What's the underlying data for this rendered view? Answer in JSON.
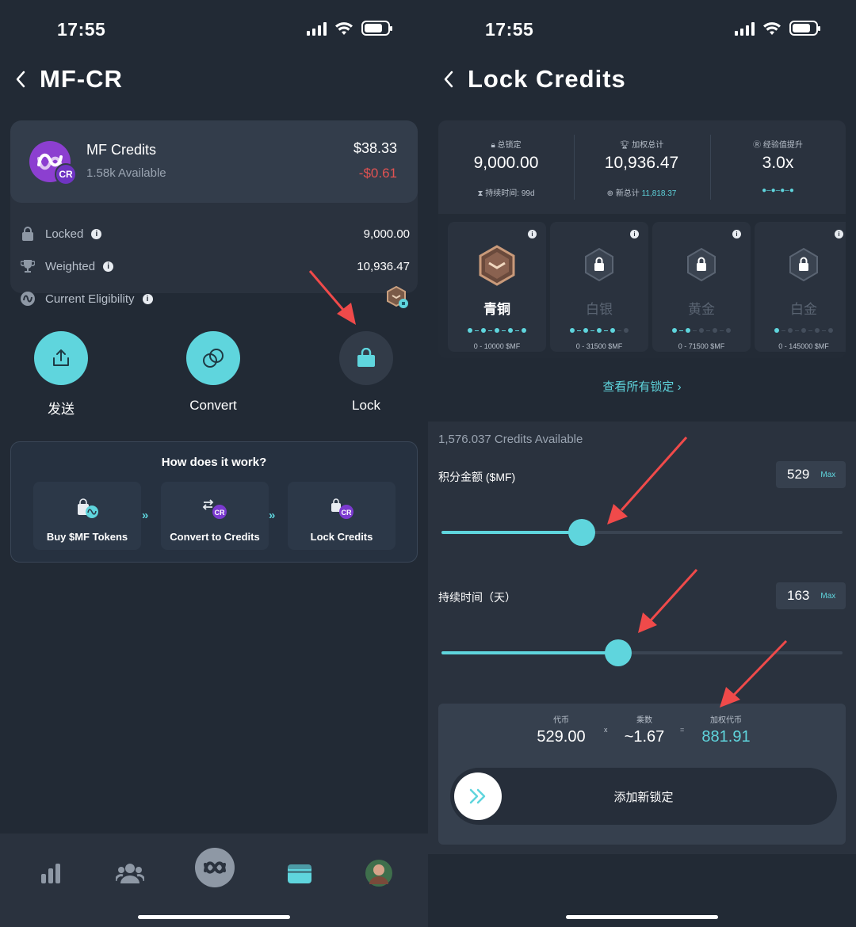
{
  "left": {
    "status": {
      "time": "17:55"
    },
    "header": {
      "title": "MF-CR"
    },
    "card": {
      "name": "MF Credits",
      "available": "1.58k Available",
      "usd_value": "$38.33",
      "change": "-$0.61",
      "coin_badge": "CR",
      "rows": [
        {
          "label": "Locked",
          "value": "9,000.00",
          "icon": "lock-icon"
        },
        {
          "label": "Weighted",
          "value": "10,936.47",
          "icon": "trophy-icon"
        },
        {
          "label": "Current Eligibility",
          "value": "",
          "icon": "token-icon"
        }
      ]
    },
    "actions": [
      {
        "label": "发送",
        "icon": "share-icon"
      },
      {
        "label": "Convert",
        "icon": "convert-icon"
      },
      {
        "label": "Lock",
        "icon": "bag-lock-icon"
      }
    ],
    "how": {
      "title": "How does it work?",
      "steps": [
        {
          "label": "Buy $MF Tokens",
          "icon": "shopping-bag-icon"
        },
        {
          "label": "Convert to Credits",
          "icon": "exchange-icon"
        },
        {
          "label": "Lock Credits",
          "icon": "lock-icon"
        }
      ],
      "separator": "»"
    },
    "tabs": [
      "stats-icon",
      "community-icon",
      "home-logo-icon",
      "wallet-icon",
      "profile-avatar-icon"
    ]
  },
  "right": {
    "status": {
      "time": "17:55"
    },
    "header": {
      "title": "Lock Credits"
    },
    "stats": [
      {
        "label": "总锁定",
        "value": "9,000.00",
        "sub_label": "持续时间: 99d",
        "sub_value": ""
      },
      {
        "label": "加权总计",
        "value": "10,936.47",
        "sub_label": "新总计",
        "sub_value": "11,818.37"
      },
      {
        "label": "经验值提升",
        "value": "3.0x",
        "sub_label": "",
        "sub_value": ""
      }
    ],
    "tiers": [
      {
        "name": "青铜",
        "range": "0 - 10000 $MF",
        "active": true,
        "progress": 5
      },
      {
        "name": "白银",
        "range": "0 - 31500 $MF",
        "active": false,
        "progress": 4
      },
      {
        "name": "黄金",
        "range": "0 - 71500 $MF",
        "active": false,
        "progress": 2
      },
      {
        "name": "白金",
        "range": "0 - 145000 $MF",
        "active": false,
        "progress": 1
      }
    ],
    "view_all": "查看所有锁定",
    "available": "1,576.037 Credits Available",
    "amount": {
      "label": "积分金额 ($MF)",
      "value": "529",
      "max": "Max",
      "fraction": 0.35
    },
    "duration": {
      "label": "持续时间（天）",
      "value": "163",
      "max": "Max",
      "fraction": 0.44
    },
    "calc": {
      "token_label": "代币",
      "token_value": "529.00",
      "mult_label": "乘数",
      "mult_value": "~1.67",
      "weighted_label": "加权代币",
      "weighted_value": "881.91",
      "times": "x",
      "equals": "="
    },
    "swipe_label": "添加新锁定"
  },
  "colors": {
    "accent": "#5fd5dd",
    "negative": "#e05252",
    "background": "#222a35",
    "annotation": "#f04a4a"
  }
}
